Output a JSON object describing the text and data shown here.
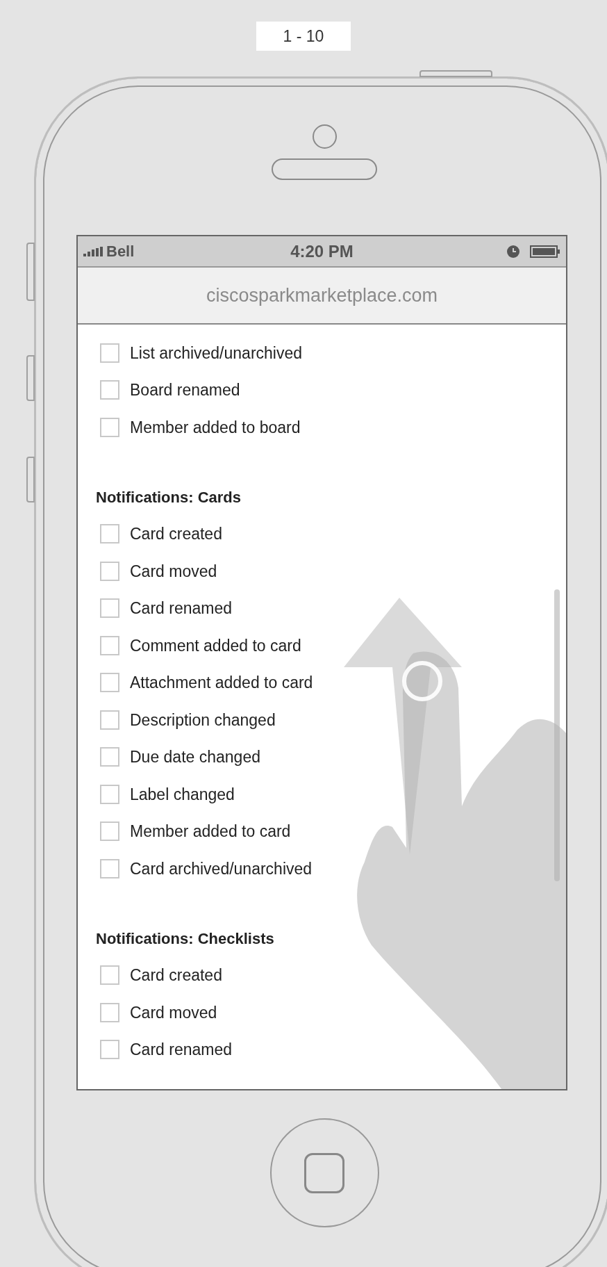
{
  "page_label": "1 - 10",
  "status_bar": {
    "carrier": "Bell",
    "time": "4:20 PM"
  },
  "address_bar": {
    "url": "ciscosparkmarketplace.com"
  },
  "content": [
    {
      "kind": "checkbox",
      "label": "List archived/unarchived",
      "checked": false
    },
    {
      "kind": "checkbox",
      "label": "Board renamed",
      "checked": false
    },
    {
      "kind": "checkbox",
      "label": "Member added to board",
      "checked": false
    },
    {
      "kind": "heading",
      "label": "Notifications: Cards"
    },
    {
      "kind": "checkbox",
      "label": "Card created",
      "checked": false
    },
    {
      "kind": "checkbox",
      "label": "Card moved",
      "checked": false
    },
    {
      "kind": "checkbox",
      "label": "Card renamed",
      "checked": false
    },
    {
      "kind": "checkbox",
      "label": "Comment added to card",
      "checked": false
    },
    {
      "kind": "checkbox",
      "label": "Attachment added to card",
      "checked": false
    },
    {
      "kind": "checkbox",
      "label": "Description changed",
      "checked": false
    },
    {
      "kind": "checkbox",
      "label": "Due date changed",
      "checked": false
    },
    {
      "kind": "checkbox",
      "label": "Label changed",
      "checked": false
    },
    {
      "kind": "checkbox",
      "label": "Member added to card",
      "checked": false
    },
    {
      "kind": "checkbox",
      "label": "Card archived/unarchived",
      "checked": false
    },
    {
      "kind": "heading",
      "label": "Notifications: Checklists"
    },
    {
      "kind": "checkbox",
      "label": "Card created",
      "checked": false
    },
    {
      "kind": "checkbox",
      "label": "Card moved",
      "checked": false
    },
    {
      "kind": "checkbox",
      "label": "Card renamed",
      "checked": false
    }
  ]
}
